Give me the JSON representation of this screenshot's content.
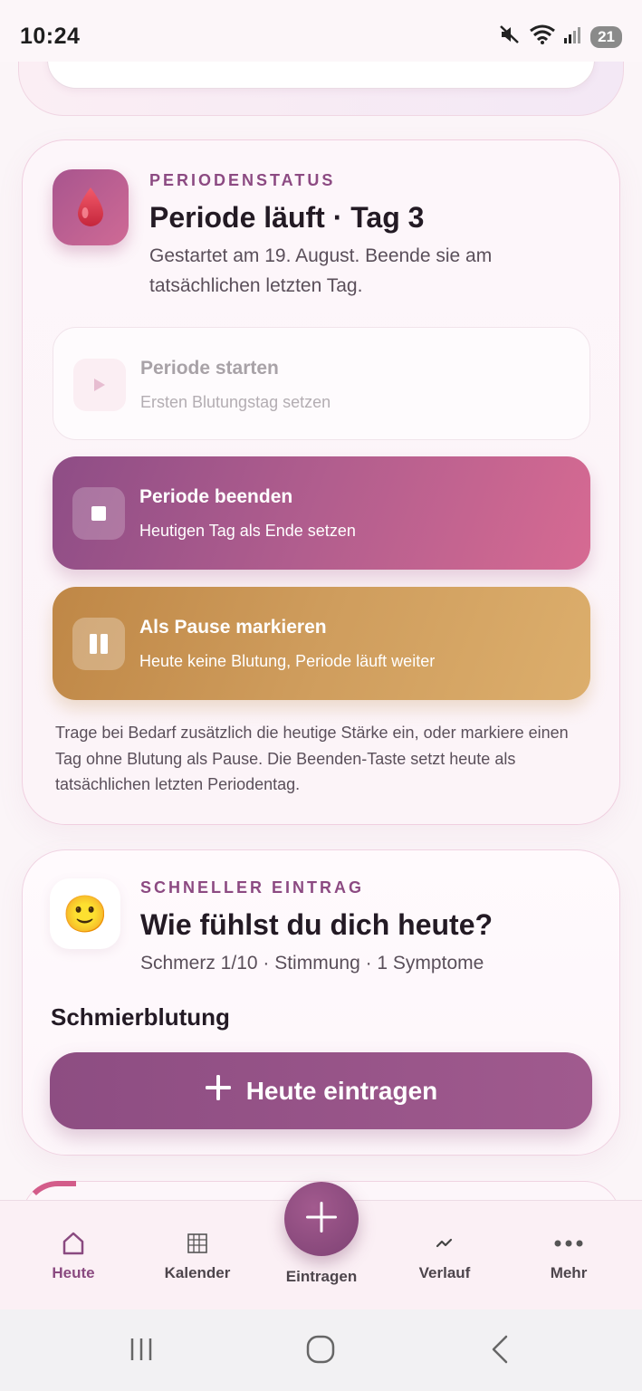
{
  "status_bar": {
    "time": "10:24",
    "battery": "21",
    "icons": [
      "mute-icon",
      "wifi-icon",
      "signal-icon"
    ]
  },
  "period_status": {
    "eyebrow": "PERIODENSTATUS",
    "title": "Periode läuft · Tag 3",
    "subtitle": "Gestartet am 19. August. Beende sie am tatsächlichen letzten Tag.",
    "icon": "blood-drop-icon",
    "actions": [
      {
        "label": "Periode starten",
        "desc": "Ersten Blutungstag setzen",
        "icon": "play-icon",
        "enabled": false
      },
      {
        "label": "Periode beenden",
        "desc": "Heutigen Tag als Ende setzen",
        "icon": "stop-icon",
        "enabled": true
      },
      {
        "label": "Als Pause markieren",
        "desc": "Heute keine Blutung, Periode läuft weiter",
        "icon": "pause-icon",
        "enabled": true
      }
    ],
    "note": "Trage bei Bedarf zusätzlich die heutige Stärke ein, oder markiere einen Tag ohne Blutung als Pause. Die Beenden-Taste setzt heute als tatsächlichen letzten Periodentag."
  },
  "quick_entry": {
    "eyebrow": "SCHNELLER EINTRAG",
    "title": "Wie fühlst du dich heute?",
    "summary": "Schmerz 1/10 · Stimmung · 1 Symptome",
    "emoji": "🙂",
    "flow_label": "Schmierblutung",
    "cta_label": "Heute eintragen"
  },
  "bottom_nav": {
    "items": [
      {
        "label": "Heute",
        "icon": "home-icon",
        "active": true
      },
      {
        "label": "Kalender",
        "icon": "calendar-grid-icon",
        "active": false
      },
      {
        "label": "Eintragen",
        "icon": "plus-icon",
        "active": false
      },
      {
        "label": "Verlauf",
        "icon": "trend-icon",
        "active": false
      },
      {
        "label": "Mehr",
        "icon": "more-dots-icon",
        "active": false
      }
    ]
  },
  "colors": {
    "accent": "#8a4a80",
    "end_gradient": [
      "#8e4d86",
      "#d66a92"
    ],
    "pause_gradient": [
      "#bf8746",
      "#dcae6c"
    ]
  }
}
